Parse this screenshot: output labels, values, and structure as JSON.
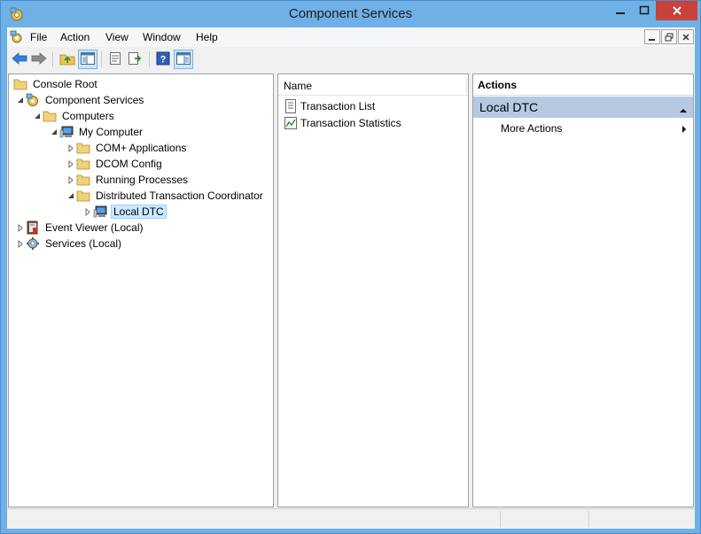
{
  "window": {
    "title": "Component Services",
    "accent_color": "#6fb0e6",
    "close_color": "#c7423a"
  },
  "menu": {
    "items": [
      "File",
      "Action",
      "View",
      "Window",
      "Help"
    ]
  },
  "toolbar": {
    "buttons": [
      "back-arrow-icon",
      "forward-arrow-icon",
      "up-folder-icon",
      "show-hide-tree-icon",
      "properties-icon",
      "export-list-icon",
      "help-icon",
      "show-hide-action-pane-icon"
    ]
  },
  "tree": {
    "items": [
      {
        "label": "Console Root",
        "icon": "folder-icon"
      },
      {
        "label": "Component Services",
        "icon": "component-services-icon"
      },
      {
        "label": "Computers",
        "icon": "folder-icon"
      },
      {
        "label": "My Computer",
        "icon": "computer-icon"
      },
      {
        "label": "COM+ Applications",
        "icon": "folder-icon"
      },
      {
        "label": "DCOM Config",
        "icon": "folder-icon"
      },
      {
        "label": "Running Processes",
        "icon": "folder-icon"
      },
      {
        "label": "Distributed Transaction Coordinator",
        "icon": "folder-icon"
      },
      {
        "label": "Local DTC",
        "icon": "computer-icon"
      },
      {
        "label": "Event Viewer (Local)",
        "icon": "event-viewer-icon"
      },
      {
        "label": "Services (Local)",
        "icon": "services-gear-icon"
      }
    ],
    "selected": "Local DTC"
  },
  "list": {
    "column_header": "Name",
    "items": [
      {
        "label": "Transaction List",
        "icon": "list-document-icon"
      },
      {
        "label": "Transaction Statistics",
        "icon": "statistics-chart-icon"
      }
    ]
  },
  "actions": {
    "header": "Actions",
    "section_title": "Local DTC",
    "more_actions": "More Actions",
    "section_color": "#b6c9e3"
  }
}
